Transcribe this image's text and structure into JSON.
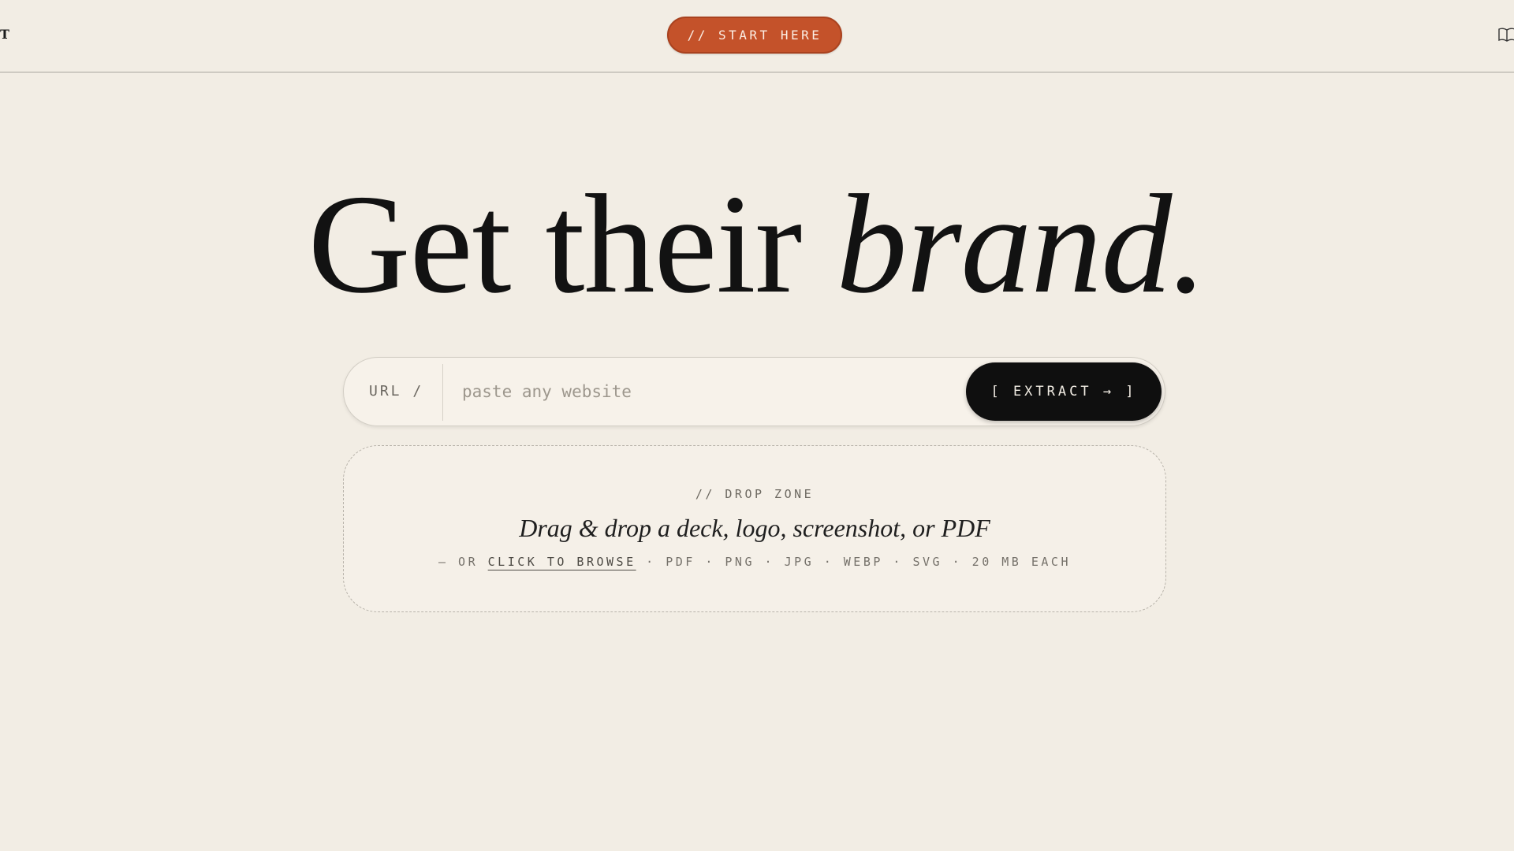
{
  "header": {
    "brand_letter": "T",
    "start_button": "// START HERE",
    "docs_icon": "open-book-icon"
  },
  "hero": {
    "headline_plain": "Get their ",
    "headline_italic": "brand."
  },
  "url_form": {
    "prefix": "URL /",
    "placeholder": "paste any website",
    "value": "",
    "submit_label": "[ EXTRACT → ]"
  },
  "drop_zone": {
    "label": "// DROP ZONE",
    "title": "Drag & drop a deck, logo, screenshot, or PDF",
    "lead": "— OR ",
    "browse_link": "CLICK TO BROWSE",
    "formats": " · PDF · PNG · JPG · WEBP · SVG · 20 MB EACH"
  },
  "colors": {
    "background": "#f2ede4",
    "accent": "#c4522a",
    "primary_button": "#0f0f0f"
  }
}
